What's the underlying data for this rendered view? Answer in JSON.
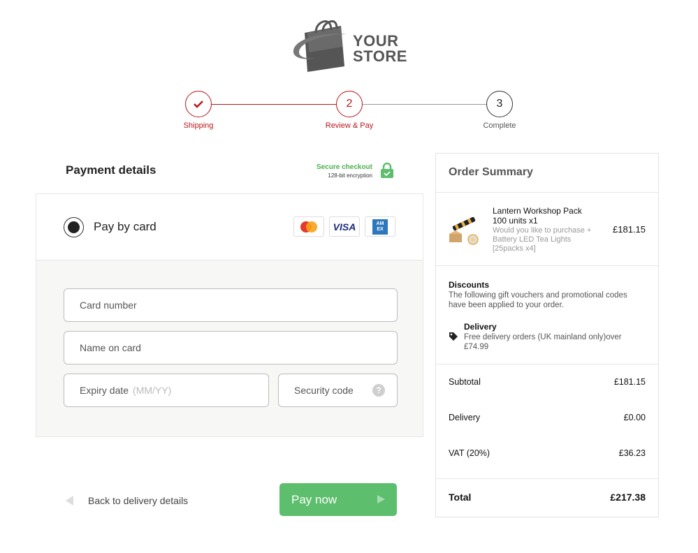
{
  "brand": {
    "line1": "YOUR",
    "line2": "STORE"
  },
  "steps": [
    {
      "number": "",
      "label": "Shipping",
      "state": "done"
    },
    {
      "number": "2",
      "label": "Review & Pay",
      "state": "active"
    },
    {
      "number": "3",
      "label": "Complete",
      "state": "pending"
    }
  ],
  "payment": {
    "title": "Payment details",
    "secure_title": "Secure checkout",
    "secure_sub": "128-bit encryption",
    "method_label": "Pay by card",
    "card_brands": [
      "mastercard-icon",
      "visa-icon",
      "amex-icon"
    ],
    "visa_text": "VISA",
    "amex_text": "AM EX",
    "fields": {
      "card_number": "Card number",
      "name_on_card": "Name on card",
      "expiry": "Expiry date",
      "expiry_hint": "(MM/YY)",
      "security": "Security code",
      "security_help": "?"
    },
    "back_label": "Back to delivery details",
    "pay_label": "Pay now"
  },
  "summary": {
    "title": "Order Summary",
    "product": {
      "name": "Lantern Workshop Pack 100 units x1",
      "upsell": "Would you like to purchase + Battery LED Tea Lights [25packs x4]",
      "price": "£181.15"
    },
    "discounts": {
      "title": "Discounts",
      "text": "The following gift vouchers and promotional codes have been applied to your order.",
      "delivery_title": "Delivery",
      "delivery_text": "Free delivery orders (UK mainland only)over £74.99"
    },
    "subtotal_label": "Subtotal",
    "subtotal": "£181.15",
    "delivery_label": "Delivery",
    "delivery": "£0.00",
    "vat_label": "VAT (20%)",
    "vat": "£36.23",
    "total_label": "Total",
    "total": "£217.38"
  },
  "colors": {
    "accent_red": "#b8161c",
    "success_green": "#5dbe6d"
  }
}
